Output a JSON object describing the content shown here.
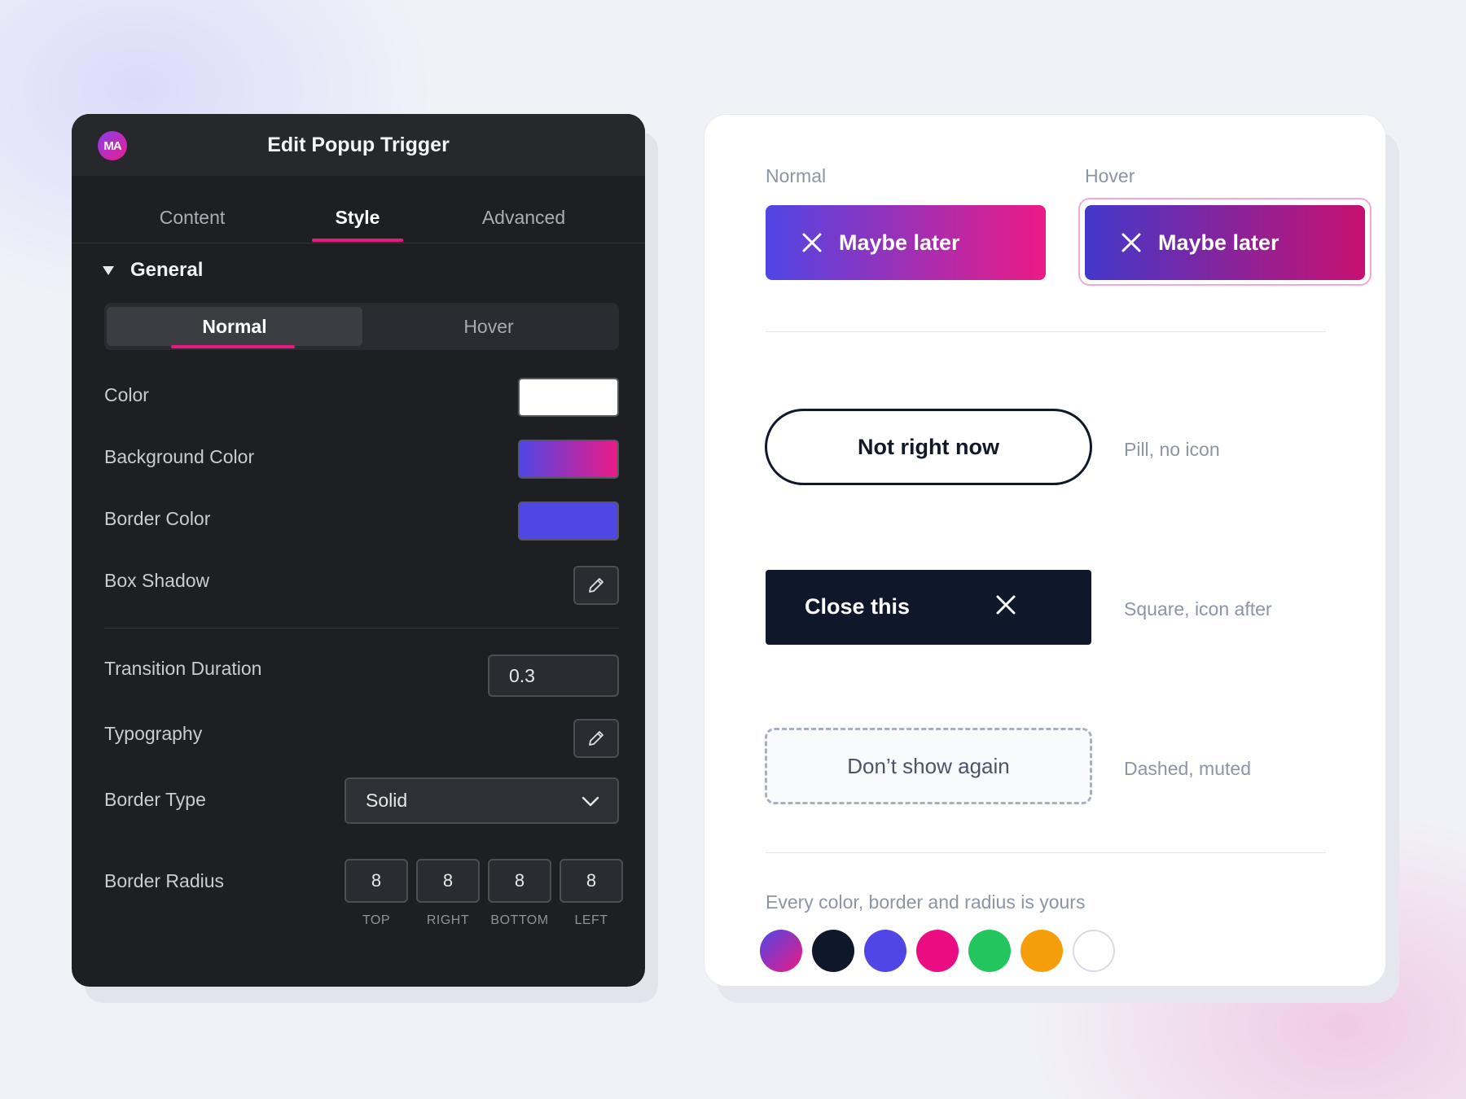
{
  "editor": {
    "title": "Edit Popup Trigger",
    "logo_text": "MA",
    "tabs": [
      {
        "label": "Content"
      },
      {
        "label": "Style"
      },
      {
        "label": "Advanced"
      }
    ],
    "active_tab": "Style",
    "section": "General",
    "state_toggle": [
      {
        "label": "Normal"
      },
      {
        "label": "Hover"
      }
    ],
    "active_state": "Normal",
    "fields": {
      "color_label": "Color",
      "background_color_label": "Background Color",
      "border_color_label": "Border Color",
      "box_shadow_label": "Box Shadow",
      "transition_duration_label": "Transition Duration",
      "transition_duration_value": "0.3",
      "typography_label": "Typography",
      "border_type_label": "Border Type",
      "border_type_value": "Solid",
      "border_radius_label": "Border Radius",
      "border_radius_values": [
        "8",
        "8",
        "8",
        "8"
      ],
      "border_radius_captions": [
        "TOP",
        "RIGHT",
        "BOTTOM",
        "LEFT"
      ]
    },
    "colors": {
      "color_swatch": "#ffffff",
      "background_gradient": [
        "#4f46e5",
        "#ec1a85"
      ],
      "border_color": "#4f46e5",
      "accent": "#e8197f"
    }
  },
  "preview": {
    "normal_caption": "Normal",
    "hover_caption": "Hover",
    "maybe_later": "Maybe later",
    "pill_button": "Not right now",
    "pill_desc": "Pill, no icon",
    "square_button": "Close this",
    "square_desc": "Square, icon after",
    "dashed_button": "Don’t show again",
    "dashed_desc": "Dashed, muted",
    "footer_caption": "Every color, border and radius is yours",
    "palette": [
      {
        "name": "gradient",
        "value": "linear-gradient(135deg,#4f46e5,#ec1a85)"
      },
      {
        "name": "navy",
        "value": "#0f172a"
      },
      {
        "name": "indigo",
        "value": "#4f46e5"
      },
      {
        "name": "pink",
        "value": "#ec0c82"
      },
      {
        "name": "green",
        "value": "#22c55e"
      },
      {
        "name": "amber",
        "value": "#f59e0b"
      },
      {
        "name": "white",
        "value": "#ffffff"
      }
    ]
  }
}
